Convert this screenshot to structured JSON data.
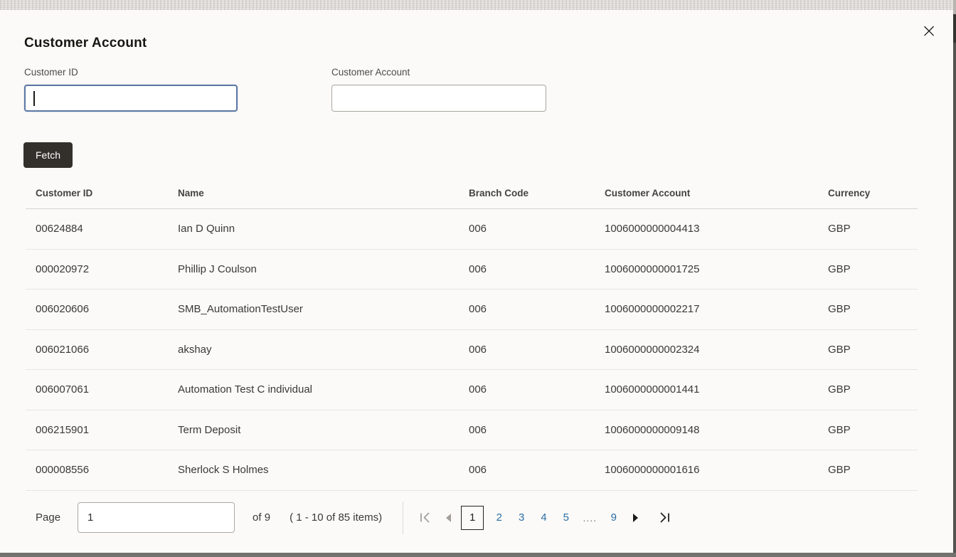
{
  "modal": {
    "title": "Customer Account",
    "close_icon": "×"
  },
  "filters": {
    "customer_id": {
      "label": "Customer ID",
      "value": "",
      "placeholder": ""
    },
    "customer_account": {
      "label": "Customer Account",
      "value": "",
      "placeholder": ""
    }
  },
  "fetch_button_label": "Fetch",
  "table": {
    "columns": [
      "Customer ID",
      "Name",
      "Branch Code",
      "Customer Account",
      "Currency"
    ],
    "rows": [
      [
        "00624884",
        "Ian D Quinn",
        "006",
        "1006000000004413",
        "GBP"
      ],
      [
        "000020972",
        "Phillip J Coulson",
        "006",
        "1006000000001725",
        "GBP"
      ],
      [
        "006020606",
        "SMB_AutomationTestUser",
        "006",
        "1006000000002217",
        "GBP"
      ],
      [
        "006021066",
        "akshay",
        "006",
        "1006000000002324",
        "GBP"
      ],
      [
        "006007061",
        "Automation Test C individual",
        "006",
        "1006000000001441",
        "GBP"
      ],
      [
        "006215901",
        "Term Deposit",
        "006",
        "1006000000009148",
        "GBP"
      ],
      [
        "000008556",
        "Sherlock S Holmes",
        "006",
        "1006000000001616",
        "GBP"
      ]
    ]
  },
  "pagination": {
    "page_label": "Page",
    "page_value": "1",
    "of_text": "of 9",
    "items_text": "( 1 - 10 of 85 items)",
    "current_page": "1",
    "pages": [
      "2",
      "3",
      "4",
      "5"
    ],
    "ellipsis": "....",
    "last_page": "9"
  },
  "colors": {
    "accent_blue": "#2b6ea6",
    "focus_border": "#5d79a6",
    "button_dark": "#33302c",
    "text_dark": "#3b3936",
    "separator": "#e9e6e2"
  }
}
